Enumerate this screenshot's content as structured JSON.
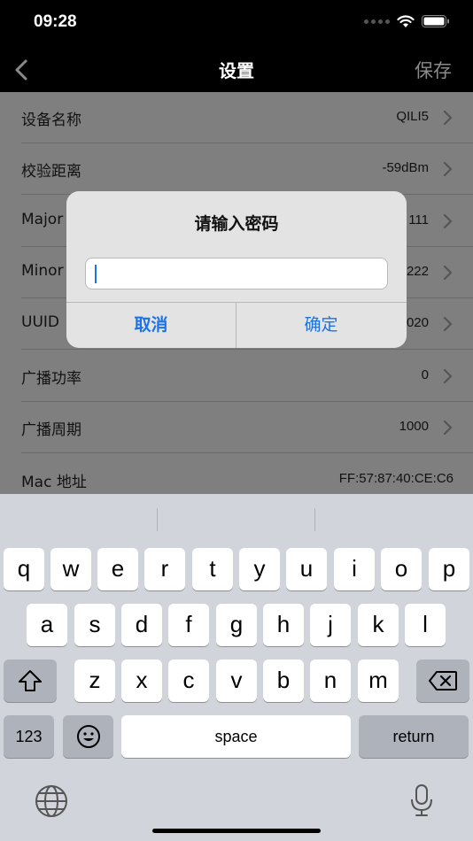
{
  "status": {
    "time": "09:28"
  },
  "nav": {
    "title": "设置",
    "save_label": "保存"
  },
  "settings": [
    {
      "label": "设备名称",
      "value": "QILI5",
      "chevron": true
    },
    {
      "label": "校验距离",
      "value": "-59dBm",
      "chevron": true
    },
    {
      "label": "Major",
      "value": "111",
      "chevron": true
    },
    {
      "label": "Minor",
      "value": "222",
      "chevron": true
    },
    {
      "label": "UUID",
      "value": "020",
      "chevron": true
    },
    {
      "label": "广播功率",
      "value": "0",
      "chevron": true
    },
    {
      "label": "广播周期",
      "value": "1000",
      "chevron": true
    },
    {
      "label": "Mac 地址",
      "value": "FF:57:87:40:CE:C6",
      "chevron": false
    }
  ],
  "dialog": {
    "title": "请输入密码",
    "input_value": "",
    "cancel_label": "取消",
    "confirm_label": "确定"
  },
  "keyboard": {
    "row1": [
      "q",
      "w",
      "e",
      "r",
      "t",
      "y",
      "u",
      "i",
      "o",
      "p"
    ],
    "row2": [
      "a",
      "s",
      "d",
      "f",
      "g",
      "h",
      "j",
      "k",
      "l"
    ],
    "row3": [
      "z",
      "x",
      "c",
      "v",
      "b",
      "n",
      "m"
    ],
    "numbers_label": "123",
    "space_label": "space",
    "return_label": "return",
    "icons": [
      "shift-icon",
      "backspace-icon",
      "emoji-icon",
      "globe-icon",
      "microphone-icon"
    ]
  },
  "colors": {
    "accent": "#1a73e8",
    "nav_bg": "#000000",
    "keyboard_bg": "#d1d4da"
  }
}
